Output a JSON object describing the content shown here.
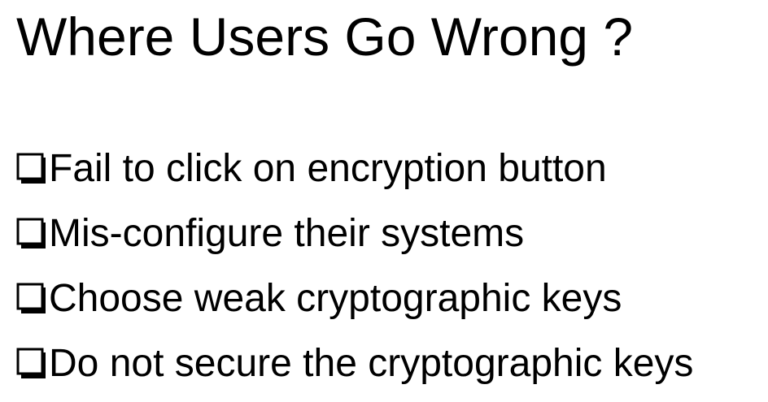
{
  "slide": {
    "title": "Where Users Go Wrong ?",
    "bullet_icon": "checkbox-icon",
    "text_color": "#000000",
    "background": "#ffffff",
    "bullets": [
      "Fail to click on encryption button",
      "Mis-configure their systems",
      "Choose weak cryptographic keys",
      "Do not secure the cryptographic keys"
    ]
  }
}
